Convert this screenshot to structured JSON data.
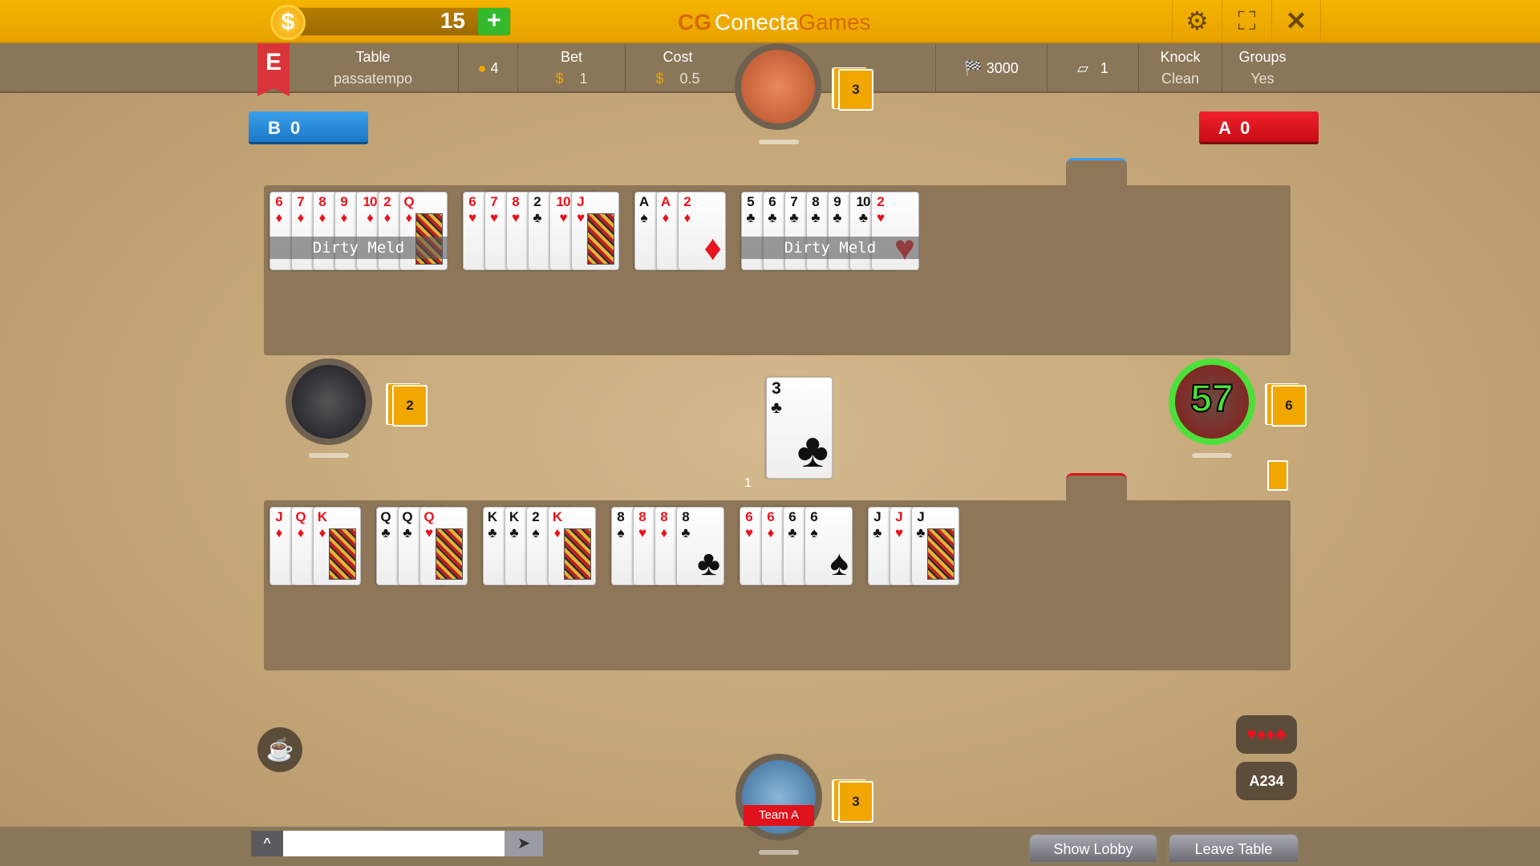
{
  "topbar": {
    "coins": "15",
    "coin_symbol": "$",
    "add_label": "+",
    "logo_mark": "CG",
    "logo_a": "Conecta",
    "logo_b": "Games",
    "settings_icon": "gear-icon",
    "fullscreen_icon": "fullscreen-icon",
    "close_icon": "close-icon"
  },
  "info": {
    "badge": "E",
    "table_label": "Table",
    "table_name": "passatempo",
    "players": "4",
    "bet_label": "Bet",
    "bet_currency": "$",
    "bet_value": "1",
    "cost_label": "Cost",
    "cost_currency": "$",
    "cost_value": "0.5",
    "goal": "3000",
    "discards": "1",
    "knock_label": "Knock",
    "knock_value": "Clean",
    "groups_label": "Groups",
    "groups_value": "Yes"
  },
  "teams": {
    "b": "B 0",
    "a": "A 0",
    "b_color": "#1c78c8",
    "a_color": "#e0121c"
  },
  "top_melds": [
    {
      "cards": [
        "6♦",
        "7♦",
        "8♦",
        "9♦",
        "10♦",
        "2♦",
        "Q♦"
      ],
      "label": "Dirty Meld"
    },
    {
      "cards": [
        "6♥",
        "7♥",
        "8♥",
        "2♣",
        "10♥",
        "J♥"
      ],
      "label": ""
    },
    {
      "cards": [
        "A♠",
        "A♦",
        "2♦"
      ],
      "label": ""
    },
    {
      "cards": [
        "5♣",
        "6♣",
        "7♣",
        "8♣",
        "9♣",
        "10♣",
        "2♥"
      ],
      "label": "Dirty Meld"
    }
  ],
  "bottom_melds": [
    {
      "cards": [
        "J♦",
        "Q♦",
        "K♦"
      ],
      "label": ""
    },
    {
      "cards": [
        "Q♣",
        "Q♣",
        "Q♥"
      ],
      "label": ""
    },
    {
      "cards": [
        "K♣",
        "K♣",
        "2♠",
        "K♦"
      ],
      "label": ""
    },
    {
      "cards": [
        "8♠",
        "8♥",
        "8♦",
        "8♣"
      ],
      "label": ""
    },
    {
      "cards": [
        "6♥",
        "6♦",
        "6♣",
        "6♠"
      ],
      "label": ""
    },
    {
      "cards": [
        "J♣",
        "J♥",
        "J♣"
      ],
      "label": ""
    }
  ],
  "discard": {
    "card": "3♣",
    "count": "1"
  },
  "players": {
    "top": {
      "cards": "3"
    },
    "left": {
      "cards": "2"
    },
    "right": {
      "cards": "6",
      "timer": "57"
    },
    "bottom": {
      "cards": "3",
      "team": "Team A"
    }
  },
  "chat": {
    "placeholder": "",
    "toggle": "^",
    "send": "➤"
  },
  "buttons": {
    "show_lobby": "Show Lobby",
    "leave_table": "Leave Table"
  }
}
